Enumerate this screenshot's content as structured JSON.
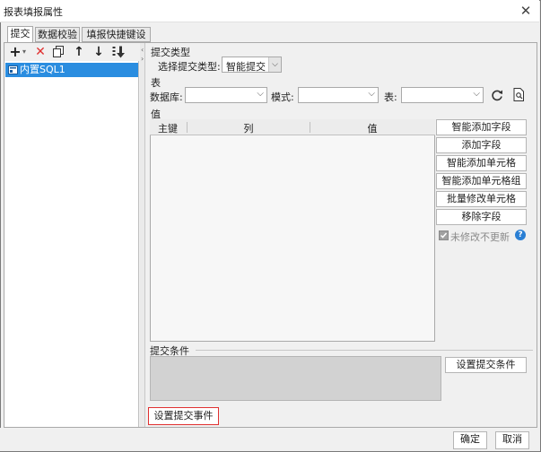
{
  "window": {
    "title": "报表填报属性",
    "close_glyph": "✕"
  },
  "tabs": [
    {
      "label": "提交",
      "active": true
    },
    {
      "label": "数据校验",
      "active": false
    },
    {
      "label": "填报快捷键设置",
      "active": false
    }
  ],
  "toolbar": {
    "icons": [
      "add-icon",
      "delete-icon",
      "copy-icon",
      "move-up-icon",
      "move-down-icon",
      "move-bottom-icon"
    ],
    "glyphs": {
      "add": "+",
      "add_dropdown": "▾",
      "delete": "✕",
      "up": "↑",
      "down": "↓"
    }
  },
  "tree": {
    "items": [
      {
        "label": "内置SQL1",
        "selected": true
      }
    ]
  },
  "submit_type": {
    "section_title": "提交类型",
    "select_label": "选择提交类型:",
    "selected_value": "智能提交"
  },
  "table_section": {
    "title": "表",
    "database_label": "数据库:",
    "schema_label": "模式:",
    "table_label": "表:"
  },
  "value_section": {
    "title": "值",
    "columns": [
      "主键",
      "列",
      "值"
    ]
  },
  "side_buttons": [
    "智能添加字段",
    "添加字段",
    "智能添加单元格",
    "智能添加单元格组",
    "批量修改单元格",
    "移除字段"
  ],
  "unmodified_checkbox": {
    "label": "未修改不更新",
    "checked": true
  },
  "submit_condition": {
    "title": "提交条件",
    "button_label": "设置提交条件"
  },
  "submit_event_button": "设置提交事件",
  "footer": {
    "ok_label": "确定",
    "cancel_label": "取消"
  },
  "colors": {
    "selection": "#2a8de0",
    "delete_red": "#e03030",
    "help_blue": "#2a7fd4",
    "highlight_border": "#e03030"
  }
}
